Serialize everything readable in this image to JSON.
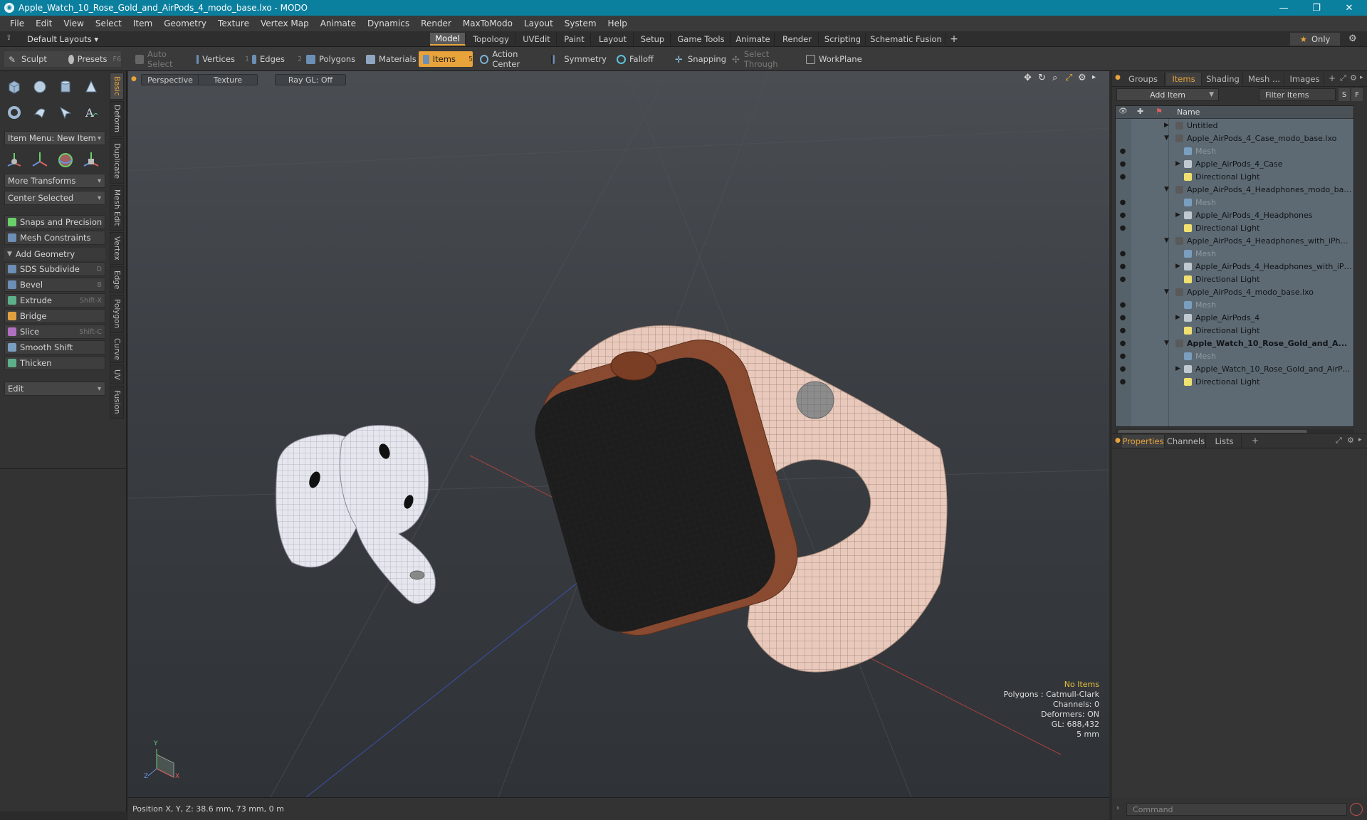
{
  "window": {
    "title": "Apple_Watch_10_Rose_Gold_and_AirPods_4_modo_base.lxo - MODO",
    "minimize": "—",
    "maximize": "❐",
    "close": "✕"
  },
  "menu": [
    "File",
    "Edit",
    "View",
    "Select",
    "Item",
    "Geometry",
    "Texture",
    "Vertex Map",
    "Animate",
    "Dynamics",
    "Render",
    "MaxToModo",
    "Layout",
    "System",
    "Help"
  ],
  "layoutbar": {
    "layouts": "Default Layouts",
    "tabs": [
      "Model",
      "Topology",
      "UVEdit",
      "Paint",
      "Layout",
      "Setup",
      "Game Tools",
      "Animate",
      "Render",
      "Scripting",
      "Schematic Fusion"
    ],
    "active_tab": "Model",
    "add": "+",
    "only": "Only"
  },
  "toolbar": {
    "sculpt": "Sculpt",
    "presets": "Presets",
    "presets_key": "F6",
    "auto_select": "Auto Select",
    "vertices": "Vertices",
    "vertices_key": "1",
    "edges": "Edges",
    "edges_key": "2",
    "polygons": "Polygons",
    "materials": "Materials",
    "items": "Items",
    "items_key": "5",
    "action_center": "Action Center",
    "symmetry": "Symmetry",
    "falloff": "Falloff",
    "snapping": "Snapping",
    "select_through": "Select Through",
    "workplane": "WorkPlane"
  },
  "leftpanel": {
    "item_menu": "Item Menu: New Item",
    "more_transforms": "More Transforms",
    "center_selected": "Center Selected",
    "tools": [
      {
        "label": "Snaps and Precision",
        "shortcut": ""
      },
      {
        "label": "Mesh Constraints",
        "shortcut": ""
      }
    ],
    "add_geometry": "Add Geometry",
    "geometry_tools": [
      {
        "label": "SDS Subdivide",
        "shortcut": "D"
      },
      {
        "label": "Bevel",
        "shortcut": "B"
      },
      {
        "label": "Extrude",
        "shortcut": "Shift-X"
      },
      {
        "label": "Bridge",
        "shortcut": ""
      },
      {
        "label": "Slice",
        "shortcut": "Shift-C"
      },
      {
        "label": "Smooth Shift",
        "shortcut": ""
      },
      {
        "label": "Thicken",
        "shortcut": ""
      }
    ],
    "edit": "Edit",
    "vtabs": [
      "Basic",
      "Deform",
      "Duplicate",
      "Mesh Edit",
      "Vertex",
      "Edge",
      "Polygon",
      "Curve",
      "UV",
      "Fusion"
    ]
  },
  "viewport": {
    "view": "Perspective",
    "shading": "Texture",
    "raygl": "Ray GL: Off",
    "hud": {
      "no_items": "No Items",
      "polygons": "Polygons : Catmull-Clark",
      "channels": "Channels: 0",
      "deformers": "Deformers: ON",
      "gl": "GL: 688,432",
      "scale": "5 mm"
    },
    "axes": {
      "x": "X",
      "y": "Y",
      "z": "Z"
    }
  },
  "statusbar": {
    "position": "Position X, Y, Z:  38.6 mm, 73 mm, 0 m"
  },
  "rightpanel": {
    "tabs": [
      "Groups",
      "Items",
      "Shading",
      "Mesh ...",
      "Images"
    ],
    "active_tab": "Items",
    "add_item": "Add Item",
    "filter": "Filter Items",
    "s_btn": "S",
    "f_btn": "F",
    "name_header": "Name",
    "tree": [
      {
        "label": "Untitled",
        "type": "scene",
        "depth": 0,
        "expanded": false
      },
      {
        "label": "Apple_AirPods_4_Case_modo_base.lxo",
        "type": "scene",
        "depth": 0,
        "expanded": true
      },
      {
        "label": "Mesh",
        "type": "mesh",
        "depth": 1
      },
      {
        "label": "Apple_AirPods_4_Case",
        "type": "group",
        "depth": 1,
        "expanded": false
      },
      {
        "label": "Directional Light",
        "type": "light",
        "depth": 1
      },
      {
        "label": "Apple_AirPods_4_Headphones_modo_bas ...",
        "type": "scene",
        "depth": 0,
        "expanded": true
      },
      {
        "label": "Mesh",
        "type": "mesh",
        "depth": 1
      },
      {
        "label": "Apple_AirPods_4_Headphones",
        "type": "group",
        "depth": 1,
        "expanded": false
      },
      {
        "label": "Directional Light",
        "type": "light",
        "depth": 1
      },
      {
        "label": "Apple_AirPods_4_Headphones_with_iPhon ...",
        "type": "scene",
        "depth": 0,
        "expanded": true
      },
      {
        "label": "Mesh",
        "type": "mesh",
        "depth": 1
      },
      {
        "label": "Apple_AirPods_4_Headphones_with_iPh ...",
        "type": "group",
        "depth": 1,
        "expanded": false
      },
      {
        "label": "Directional Light",
        "type": "light",
        "depth": 1
      },
      {
        "label": "Apple_AirPods_4_modo_base.lxo",
        "type": "scene",
        "depth": 0,
        "expanded": true
      },
      {
        "label": "Mesh",
        "type": "mesh",
        "depth": 1
      },
      {
        "label": "Apple_AirPods_4",
        "type": "group",
        "depth": 1,
        "expanded": false
      },
      {
        "label": "Directional Light",
        "type": "light",
        "depth": 1
      },
      {
        "label": "Apple_Watch_10_Rose_Gold_and_A...",
        "type": "scene",
        "depth": 0,
        "expanded": true,
        "bold": true
      },
      {
        "label": "Mesh",
        "type": "mesh",
        "depth": 1
      },
      {
        "label": "Apple_Watch_10_Rose_Gold_and_AirPo ...",
        "type": "group",
        "depth": 1,
        "expanded": false
      },
      {
        "label": "Directional Light",
        "type": "light",
        "depth": 1
      }
    ],
    "bottom_tabs": [
      "Properties",
      "Channels",
      "Lists"
    ],
    "bottom_active": "Properties",
    "command_placeholder": "Command"
  },
  "colors": {
    "accent": "#e8a33b",
    "titlebar": "#0a7f9e",
    "watch_band": "#e9c9bb",
    "watch_case": "#8a4a30",
    "airpods": "#e6e6ee"
  }
}
